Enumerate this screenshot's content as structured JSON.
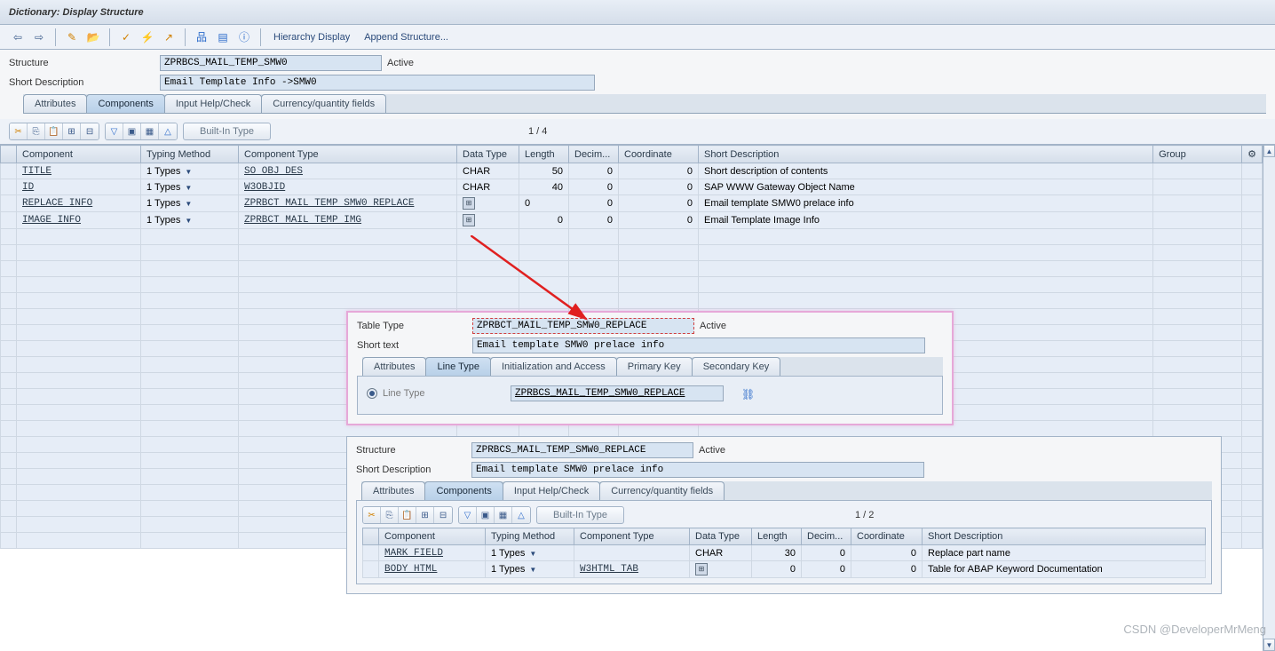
{
  "title": "Dictionary: Display Structure",
  "toolbar_links": {
    "hierarchy": "Hierarchy Display",
    "append": "Append Structure..."
  },
  "header": {
    "structure_label": "Structure",
    "structure_value": "ZPRBCS_MAIL_TEMP_SMW0",
    "status": "Active",
    "shortdesc_label": "Short Description",
    "shortdesc_value": "Email Template Info ->SMW0"
  },
  "tabs": [
    "Attributes",
    "Components",
    "Input Help/Check",
    "Currency/quantity fields"
  ],
  "builtin_label": "Built-In Type",
  "counter": "1  /  4",
  "columns": {
    "component": "Component",
    "typing": "Typing Method",
    "comptype": "Component Type",
    "datatype": "Data Type",
    "length": "Length",
    "decim": "Decim...",
    "coord": "Coordinate",
    "shortdesc": "Short Description",
    "group": "Group"
  },
  "rows": [
    {
      "component": "TITLE",
      "tm_idx": "1",
      "typing": "Types",
      "comptype": "SO_OBJ_DES",
      "datatype": "CHAR",
      "length": "50",
      "decim": "0",
      "coord": "0",
      "desc": "Short description of contents",
      "icon": false
    },
    {
      "component": "ID",
      "tm_idx": "1",
      "typing": "Types",
      "comptype": "W3OBJID",
      "datatype": "CHAR",
      "length": "40",
      "decim": "0",
      "coord": "0",
      "desc": "SAP WWW Gateway Object Name",
      "icon": false
    },
    {
      "component": "REPLACE_INFO",
      "tm_idx": "1",
      "typing": "Types",
      "comptype": "ZPRBCT_MAIL_TEMP_SMW0_REPLACE",
      "datatype": "",
      "length": "0",
      "decim": "0",
      "coord": "0",
      "desc": "Email template SMW0 prelace info",
      "icon": true
    },
    {
      "component": "IMAGE_INFO",
      "tm_idx": "1",
      "typing": "Types",
      "comptype": "ZPRBCT_MAIL_TEMP_IMG",
      "datatype": "",
      "length": "0",
      "decim": "0",
      "coord": "0",
      "desc": "Email Template Image Info",
      "icon": true
    }
  ],
  "popup1": {
    "tabletype_label": "Table Type",
    "tabletype_value": "ZPRBCT_MAIL_TEMP_SMW0_REPLACE",
    "status": "Active",
    "shorttext_label": "Short text",
    "shorttext_value": "Email template SMW0 prelace info",
    "tabs": [
      "Attributes",
      "Line Type",
      "Initialization and Access",
      "Primary Key",
      "Secondary Key"
    ],
    "linetype_label": "Line Type",
    "linetype_value": "ZPRBCS_MAIL_TEMP_SMW0_REPLACE"
  },
  "popup2": {
    "structure_label": "Structure",
    "structure_value": "ZPRBCS_MAIL_TEMP_SMW0_REPLACE",
    "status": "Active",
    "shortdesc_label": "Short Description",
    "shortdesc_value": "Email template SMW0 prelace info",
    "counter": "1  /  2",
    "rows": [
      {
        "component": "MARK_FIELD",
        "tm_idx": "1",
        "typing": "Types",
        "comptype": "",
        "datatype": "CHAR",
        "length": "30",
        "decim": "0",
        "coord": "0",
        "desc": "Replace part name",
        "icon": false
      },
      {
        "component": "BODY_HTML",
        "tm_idx": "1",
        "typing": "Types",
        "comptype": "W3HTML_TAB",
        "datatype": "",
        "length": "0",
        "decim": "0",
        "coord": "0",
        "desc": "Table for ABAP Keyword Documentation",
        "icon": true
      }
    ]
  },
  "watermark": "CSDN @DeveloperMrMeng"
}
